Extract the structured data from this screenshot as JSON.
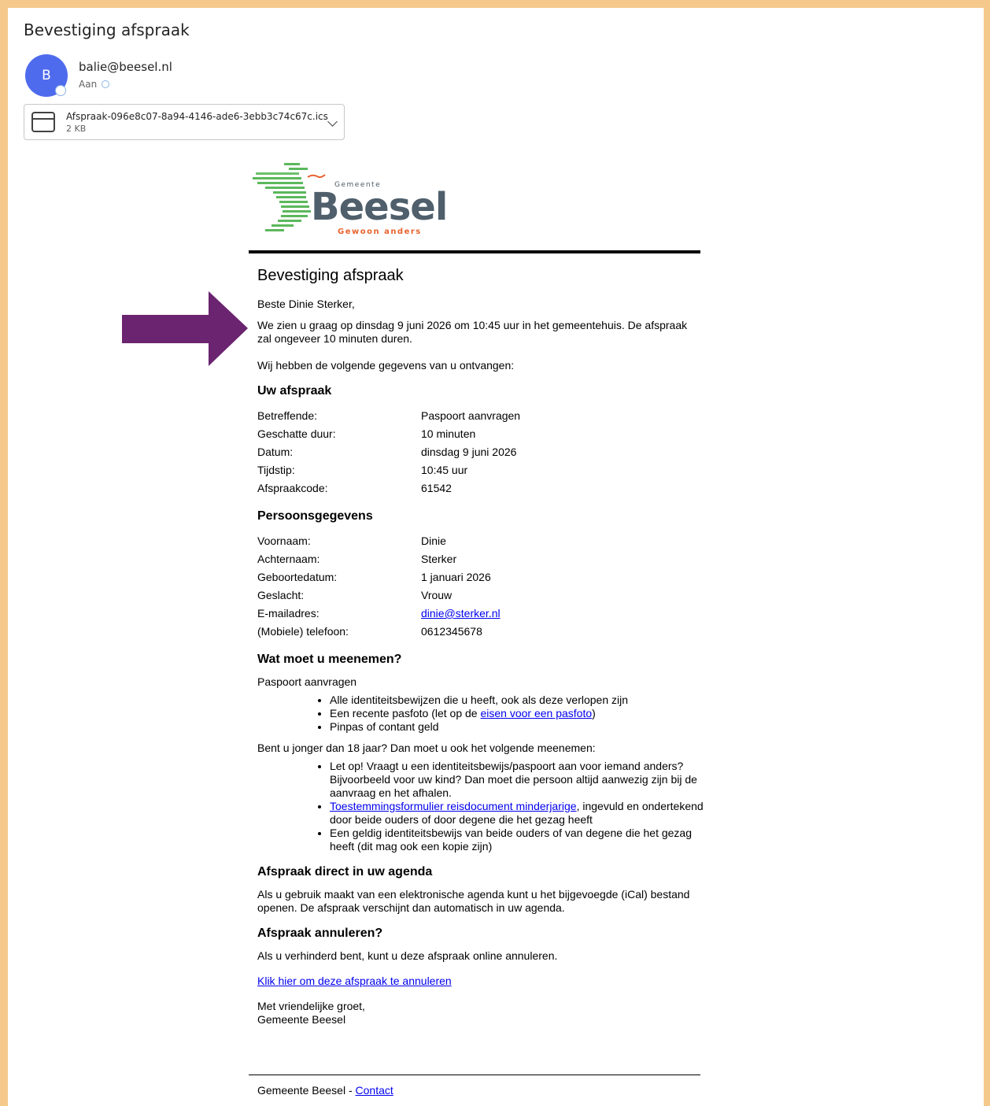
{
  "email": {
    "subject": "Bevestiging afspraak",
    "avatar_letter": "B",
    "sender": "balie@beesel.nl",
    "to_label": "Aan",
    "attachment": {
      "name": "Afspraak-096e8c07-8a94-4146-ade6-3ebb3c74c67c.ics",
      "size": "2 KB",
      "icon": "calendar-icon"
    }
  },
  "logo": {
    "gemeente": "Gemeente",
    "beesel": "Beesel",
    "tagline": "Gewoon anders"
  },
  "content": {
    "title": "Bevestiging afspraak",
    "greeting": "Beste Dinie Sterker,",
    "intro": "We zien u graag op dinsdag 9 juni 2026 om 10:45 uur in het gemeentehuis. De afspraak zal ongeveer 10 minuten duren.",
    "received": "Wij hebben de volgende gegevens van u ontvangen:",
    "appointment_heading": "Uw afspraak",
    "appointment": [
      {
        "label": "Betreffende:",
        "value": "Paspoort aanvragen"
      },
      {
        "label": "Geschatte duur:",
        "value": "10 minuten"
      },
      {
        "label": "Datum:",
        "value": "dinsdag 9 juni 2026"
      },
      {
        "label": "Tijdstip:",
        "value": "10:45 uur"
      },
      {
        "label": "Afspraakcode:",
        "value": "61542"
      }
    ],
    "personal_heading": "Persoonsgegevens",
    "personal": [
      {
        "label": "Voornaam:",
        "value": "Dinie"
      },
      {
        "label": "Achternaam:",
        "value": "Sterker"
      },
      {
        "label": "Geboortedatum:",
        "value": "1 januari 2026"
      },
      {
        "label": "Geslacht:",
        "value": "Vrouw"
      },
      {
        "label": "E-mailadres:",
        "value": "dinie@sterker.nl"
      },
      {
        "label": "(Mobiele) telefoon:",
        "value": "0612345678"
      }
    ],
    "bring_heading": "Wat moet u meenemen?",
    "bring_sub": "Paspoort aanvragen",
    "bring_items": {
      "item1": "Alle identiteitsbewijzen die u heeft, ook als deze verlopen zijn",
      "item2_pre": "Een recente pasfoto (let op de ",
      "item2_link": "eisen voor een pasfoto",
      "item2_post": ")",
      "item3": "Pinpas of contant geld"
    },
    "minor_intro": "Bent u  jonger dan 18 jaar? Dan moet u ook het volgende meenemen:",
    "minor_items": {
      "item1": "Let op! Vraagt u een identiteitsbewijs/paspoort aan voor iemand anders? Bijvoorbeeld voor uw kind? Dan moet die persoon altijd aanwezig zijn bij de aanvraag en het afhalen.",
      "item2_link": "Toestemmingsformulier reisdocument minderjarige",
      "item2_post": ", ingevuld en ondertekend door beide ouders of door degene die het gezag heeft",
      "item3": "Een geldig identiteitsbewijs van beide ouders of van degene die het gezag heeft (dit mag ook een kopie zijn)"
    },
    "agenda_heading": "Afspraak direct in uw agenda",
    "agenda_text": "Als u gebruik maakt van een elektronische agenda kunt u het bijgevoegde (iCal) bestand openen. De afspraak verschijnt dan automatisch in uw agenda.",
    "cancel_heading": "Afspraak annuleren?",
    "cancel_text": "Als u verhinderd bent, kunt u deze afspraak online annuleren.",
    "cancel_link": "Klik hier om deze afspraak te annuleren",
    "closing": "Met vriendelijke groet,",
    "signature": "Gemeente Beesel",
    "footer_text": "Gemeente Beesel - ",
    "footer_link": "Contact"
  },
  "colors": {
    "frame": "#f5c98b",
    "avatar": "#4f6bed",
    "arrow": "#6b2470",
    "link": "#0000ee"
  }
}
